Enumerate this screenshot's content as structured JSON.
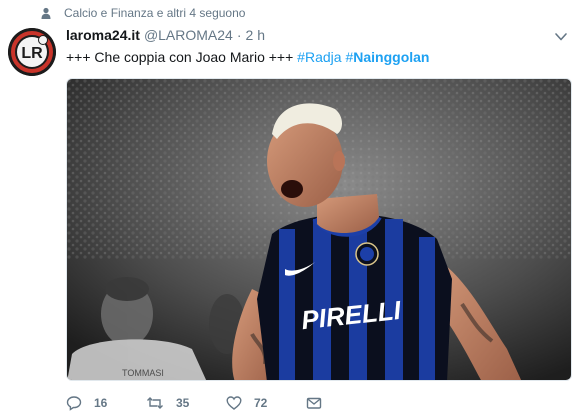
{
  "social_context": {
    "text": "Calcio e Finanza e altri 4 seguono",
    "icon": "person-icon"
  },
  "tweet": {
    "avatar_text": "LR",
    "name": "laroma24.it",
    "handle": "@LAROMA24",
    "separator": "·",
    "time": "2 h",
    "text_main": "+++ Che coppia con Joao Mario +++",
    "hashtag1_symbol": "#",
    "hashtag1_word": "Radja",
    "hashtag2_symbol": "#",
    "hashtag2_word": "Nainggolan",
    "media": {
      "jersey_sponsor": "PIRELLI",
      "background_shirt_text": "TOMMASI"
    },
    "actions": {
      "reply_count": "16",
      "retweet_count": "35",
      "like_count": "72"
    }
  },
  "colors": {
    "accent": "#1da1f2",
    "muted": "#657786",
    "text": "#14171a",
    "jersey_blue": "#1c3fa8",
    "jersey_black": "#0b0f1e"
  }
}
